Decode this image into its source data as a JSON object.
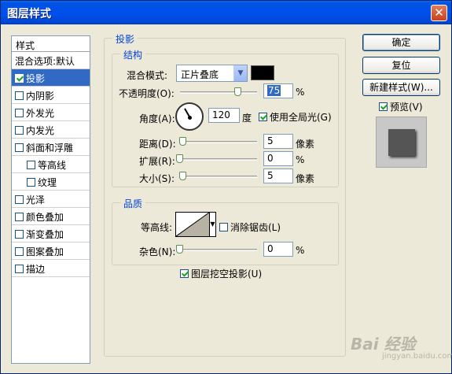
{
  "window": {
    "title": "图层样式",
    "close_glyph": "✕"
  },
  "style_list": {
    "header": "样式",
    "blend_item": "混合选项:默认",
    "items": [
      {
        "label": "投影",
        "checked": true,
        "selected": true,
        "indent": false
      },
      {
        "label": "内阴影",
        "checked": false,
        "selected": false,
        "indent": false
      },
      {
        "label": "外发光",
        "checked": false,
        "selected": false,
        "indent": false
      },
      {
        "label": "内发光",
        "checked": false,
        "selected": false,
        "indent": false
      },
      {
        "label": "斜面和浮雕",
        "checked": false,
        "selected": false,
        "indent": false
      },
      {
        "label": "等高线",
        "checked": false,
        "selected": false,
        "indent": true
      },
      {
        "label": "纹理",
        "checked": false,
        "selected": false,
        "indent": true
      },
      {
        "label": "光泽",
        "checked": false,
        "selected": false,
        "indent": false
      },
      {
        "label": "颜色叠加",
        "checked": false,
        "selected": false,
        "indent": false
      },
      {
        "label": "渐变叠加",
        "checked": false,
        "selected": false,
        "indent": false
      },
      {
        "label": "图案叠加",
        "checked": false,
        "selected": false,
        "indent": false
      },
      {
        "label": "描边",
        "checked": false,
        "selected": false,
        "indent": false
      }
    ]
  },
  "shadow": {
    "section_title": "投影",
    "structure_title": "结构",
    "blend_mode_label": "混合模式:",
    "blend_mode_value": "正片叠底",
    "shadow_color": "#000000",
    "opacity_label": "不透明度(O):",
    "opacity_value": "75",
    "opacity_unit": "%",
    "angle_label": "角度(A):",
    "angle_value": "120",
    "angle_unit": "度",
    "global_light_label": "使用全局光(G)",
    "distance_label": "距离(D):",
    "distance_value": "5",
    "distance_unit": "像素",
    "spread_label": "扩展(R):",
    "spread_value": "0",
    "spread_unit": "%",
    "size_label": "大小(S):",
    "size_value": "5",
    "size_unit": "像素"
  },
  "quality": {
    "title": "品质",
    "contour_label": "等高线:",
    "antialias_label": "消除锯齿(L)",
    "noise_label": "杂色(N):",
    "noise_value": "0",
    "noise_unit": "%",
    "knockout_label": "图层挖空投影(U)"
  },
  "buttons": {
    "ok": "确定",
    "reset": "复位",
    "new_style": "新建样式(W)...",
    "preview_label": "预览(V)"
  },
  "watermark": {
    "main": "Bai 经验",
    "sub": "jingyan.baidu.com"
  }
}
